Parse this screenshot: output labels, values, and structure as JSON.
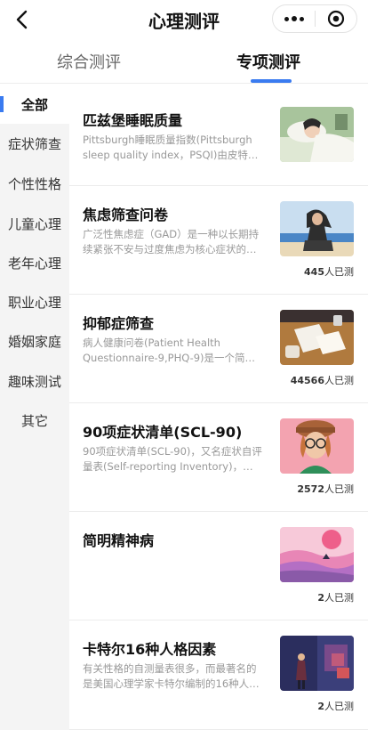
{
  "nav": {
    "title": "心理测评"
  },
  "tabs": [
    {
      "label": "综合测评",
      "active": false
    },
    {
      "label": "专项测评",
      "active": true
    }
  ],
  "colors": {
    "accent": "#3a7bf0"
  },
  "sidebar": {
    "items": [
      {
        "label": "全部",
        "active": true
      },
      {
        "label": "症状筛查"
      },
      {
        "label": "个性性格"
      },
      {
        "label": "儿童心理"
      },
      {
        "label": "老年心理"
      },
      {
        "label": "职业心理"
      },
      {
        "label": "婚姻家庭"
      },
      {
        "label": "趣味测试"
      },
      {
        "label": "其它"
      }
    ]
  },
  "cards": [
    {
      "title": "匹兹堡睡眠质量",
      "desc": "Pittsburgh睡眠质量指数(Pittsburgh sleep quality index，PSQI)由皮特斯…",
      "count": "",
      "count_suffix": "",
      "image": "sleeping-woman-image"
    },
    {
      "title": "焦虑筛查问卷",
      "desc": "广泛性焦虑症（GAD）是一种以长期持续紧张不安与过度焦虑为核心症状的…",
      "count": "445",
      "count_suffix": "人已测",
      "image": "woman-by-sea-image"
    },
    {
      "title": "抑郁症筛查",
      "desc": "病人健康问卷(Patient Health Questionnaire-9,PHQ-9)是一个简…",
      "count": "44566",
      "count_suffix": "人已测",
      "image": "desk-book-image"
    },
    {
      "title": "90项症状清单(SCL-90)",
      "desc": "90项症状清单(SCL-90)，又名症状自评量表(Self-reporting Inventory)，…",
      "count": "2572",
      "count_suffix": "人已测",
      "image": "woman-glasses-image"
    },
    {
      "title": "简明精神病",
      "desc": "",
      "count": "2",
      "count_suffix": "人已测",
      "image": "pink-landscape-image"
    },
    {
      "title": "卡特尔16种人格因素",
      "desc": "有关性格的自测量表很多，而最著名的是美国心理学家卡特尔编制的16种人…",
      "count": "2",
      "count_suffix": "人已测",
      "image": "dark-room-figure-image"
    }
  ]
}
